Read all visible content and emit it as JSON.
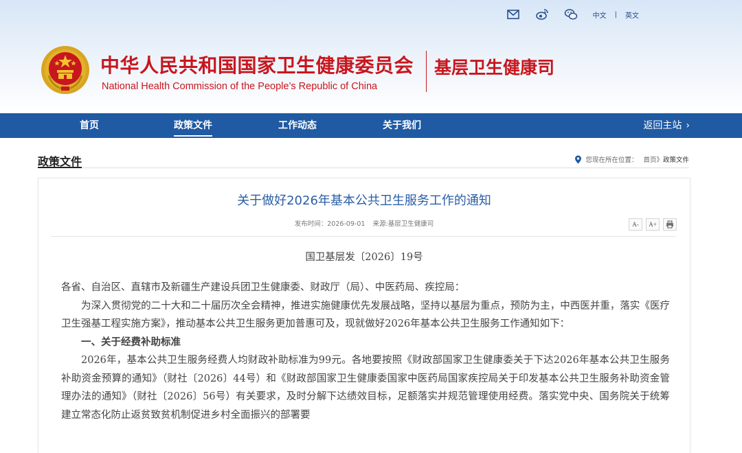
{
  "top_links": {
    "lang_cn": "中文",
    "lang_sep": "|",
    "lang_en": "英文",
    "icons": [
      "mail-icon",
      "weibo-icon",
      "wechat-icon"
    ]
  },
  "header": {
    "cn_title": "中华人民共和国国家卫生健康委员会",
    "en_title": "National Health Commission of the People’s  Republic of China",
    "dept_title": "基层卫生健康司"
  },
  "nav": {
    "items": [
      {
        "label": "首页"
      },
      {
        "label": "政策文件"
      },
      {
        "label": "工作动态"
      },
      {
        "label": "关于我们"
      }
    ],
    "active_index": 1,
    "back_label": "返回主站"
  },
  "section": {
    "title": "政策文件",
    "location_label": "您现在所在位置：",
    "crumb_home": "首页",
    "crumb_sep": "》",
    "crumb_current": "政策文件"
  },
  "article": {
    "title": "关于做好2026年基本公共卫生服务工作的通知",
    "date_label": "发布时间：",
    "date": "2026-09-01",
    "source_label": "来源:",
    "source": "基层卫生健康司",
    "tools": {
      "font_smaller": "A-",
      "font_larger": "A+"
    },
    "doc_number": "国卫基层发〔2026〕19号",
    "addressee": "各省、自治区、直辖市及新疆生产建设兵团卫生健康委、财政厅（局）、中医药局、疾控局：",
    "intro": "为深入贯彻党的二十大和二十届历次全会精神，推进实施健康优先发展战略，坚持以基层为重点，预防为主，中西医并重，落实《医疗卫生强基工程实施方案》，推动基本公共卫生服务更加普惠可及，现就做好2026年基本公共卫生服务工作通知如下：",
    "heading1": "一、关于经费补助标准",
    "para1": "2026年，基本公共卫生服务经费人均财政补助标准为99元。各地要按照《财政部国家卫生健康委关于下达2026年基本公共卫生服务补助资金预算的通知》（财社〔2026〕44号）和《财政部国家卫生健康委国家中医药局国家疾控局关于印发基本公共卫生服务补助资金管理办法的通知》（财社〔2026〕56号）有关要求，及时分解下达绩效目标，足额落实并规范管理使用经费。落实党中央、国务院关于统筹建立常态化防止返贫致贫机制促进乡村全面振兴的部署要"
  },
  "colors": {
    "brand_red": "#c8161e",
    "nav_blue": "#1f5aa3",
    "title_blue": "#2a5ea6"
  }
}
